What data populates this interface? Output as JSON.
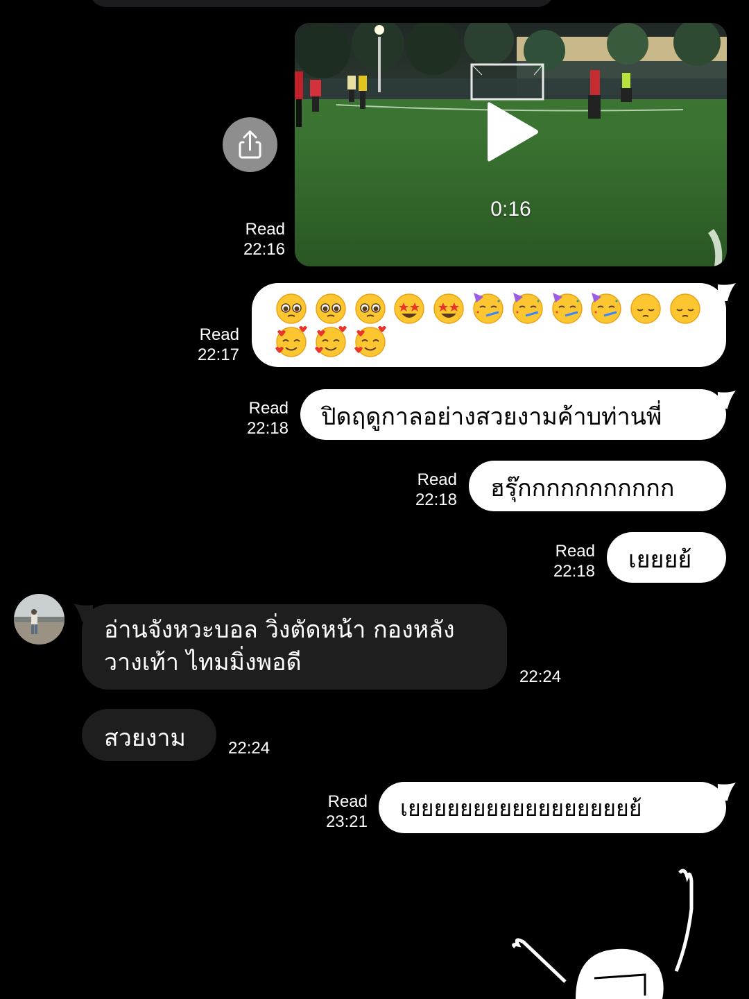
{
  "messages": [
    {
      "id": "video",
      "type": "video",
      "duration": "0:16",
      "status": "Read",
      "time": "22:16"
    },
    {
      "id": "emojis",
      "type": "emoji",
      "emoji_names": [
        "pleading-face",
        "pleading-face",
        "pleading-face",
        "star-struck",
        "star-struck",
        "partying-face",
        "partying-face",
        "partying-face",
        "partying-face",
        "pensive-face",
        "pensive-face",
        "smiling-face-with-hearts",
        "smiling-face-with-hearts",
        "smiling-face-with-hearts"
      ],
      "status": "Read",
      "time": "22:17"
    },
    {
      "id": "m1",
      "type": "text",
      "text": "ปิดฤดูกาลอย่างสวยงามค้าบท่านพี่",
      "status": "Read",
      "time": "22:18"
    },
    {
      "id": "m2",
      "type": "text",
      "text": "ฮรุ๊กกกกกกกกกกก",
      "status": "Read",
      "time": "22:18"
    },
    {
      "id": "m3",
      "type": "text",
      "text": "เยยยย้",
      "status": "Read",
      "time": "22:18"
    },
    {
      "id": "m4",
      "type": "incoming",
      "lines": [
        "อ่านจังหวะบอล วิ่งตัดหน้า กองหลัง",
        "วางเท้า ไทมมิ่งพอดี"
      ],
      "time": "22:24"
    },
    {
      "id": "m5",
      "type": "incoming",
      "text": "สวยงาม",
      "time": "22:24"
    },
    {
      "id": "m6",
      "type": "text",
      "text": "เยยยยยยยยยยยยยยยยยย้",
      "status": "Read",
      "time": "23:21"
    }
  ],
  "colors": {
    "background": "#000000",
    "outgoing_bubble": "#ffffff",
    "incoming_bubble": "#1e1e1e",
    "share_button": "#8e8e8e"
  },
  "icons": [
    "share-icon",
    "play-icon"
  ]
}
